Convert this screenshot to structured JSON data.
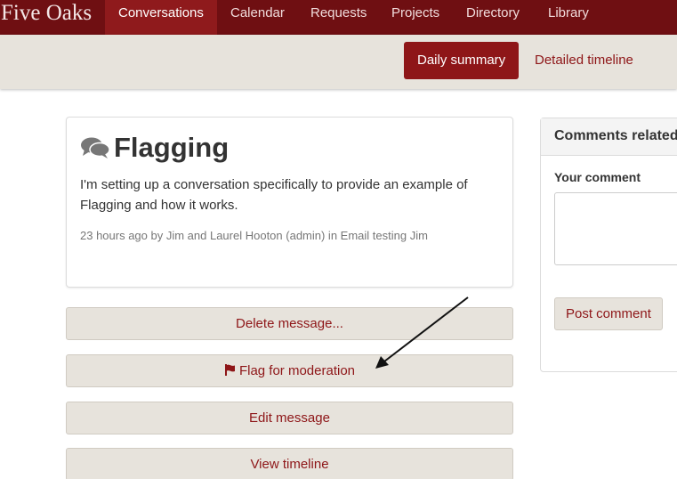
{
  "navbar": {
    "brand": "Five Oaks",
    "items": [
      {
        "label": "Conversations",
        "active": true
      },
      {
        "label": "Calendar",
        "active": false
      },
      {
        "label": "Requests",
        "active": false
      },
      {
        "label": "Projects",
        "active": false
      },
      {
        "label": "Directory",
        "active": false
      },
      {
        "label": "Library",
        "active": false
      }
    ]
  },
  "subnav": {
    "tabs": [
      {
        "label": "Daily summary",
        "active": true
      },
      {
        "label": "Detailed timeline",
        "active": false
      }
    ]
  },
  "message": {
    "icon": "comments-icon",
    "title": "Flagging",
    "body": "I'm setting up a conversation specifically to provide an example of Flagging and how it works.",
    "meta": "23 hours ago by Jim and Laurel Hooton (admin) in Email testing Jim"
  },
  "actions": [
    {
      "label": "Delete message...",
      "icon": ""
    },
    {
      "label": "Flag for moderation",
      "icon": "flag-icon"
    },
    {
      "label": "Edit message",
      "icon": ""
    },
    {
      "label": "View timeline",
      "icon": ""
    }
  ],
  "comments": {
    "title": "Comments related",
    "your_comment_label": "Your comment",
    "textarea_value": "",
    "post_label": "Post comment"
  },
  "colors": {
    "navbar_bg": "#6f0f12",
    "nav_active_bg": "#8f1a1c",
    "accent": "#8e1618",
    "subbar_bg": "#e7e3dc"
  }
}
